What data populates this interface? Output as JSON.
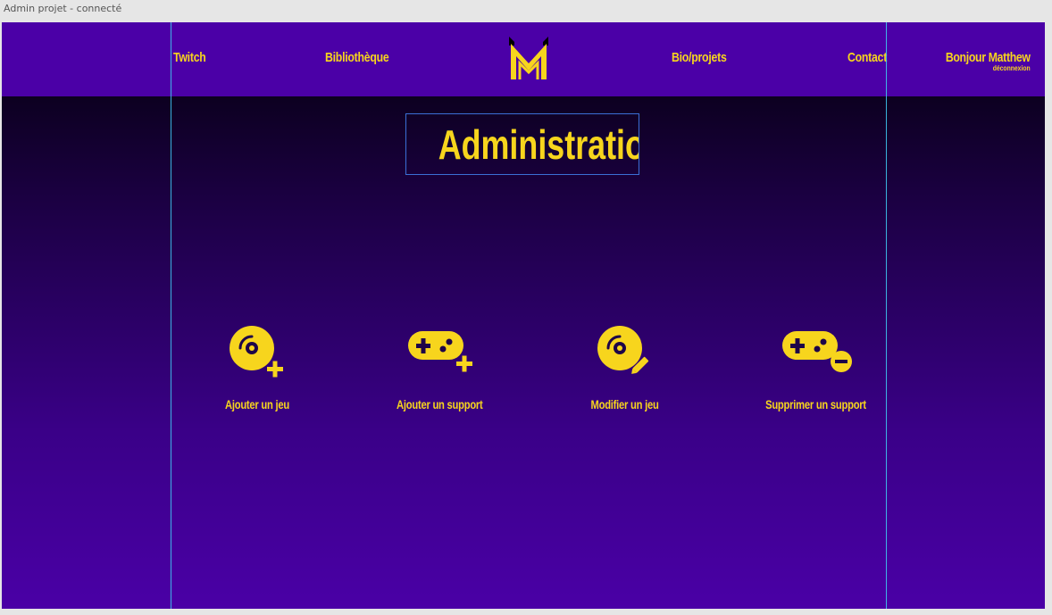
{
  "window": {
    "title": "Admin projet - connecté"
  },
  "nav": {
    "links": [
      {
        "label": "Twitch"
      },
      {
        "label": "Bibliothèque"
      },
      {
        "label": "Bio/projets"
      },
      {
        "label": "Contact"
      }
    ],
    "greeting": "Bonjour Matthew",
    "logout": "déconnexion"
  },
  "page": {
    "title": "Administration"
  },
  "actions": [
    {
      "label": "Ajouter un jeu",
      "icon": "disc-plus-icon"
    },
    {
      "label": "Ajouter un support",
      "icon": "gamepad-plus-icon"
    },
    {
      "label": "Modifier un jeu",
      "icon": "disc-edit-icon"
    },
    {
      "label": "Supprimer un support",
      "icon": "gamepad-minus-icon"
    }
  ],
  "colors": {
    "accent": "#f7d51d",
    "nav_bg": "#4b00a7",
    "guide": "#3ec7f0"
  }
}
